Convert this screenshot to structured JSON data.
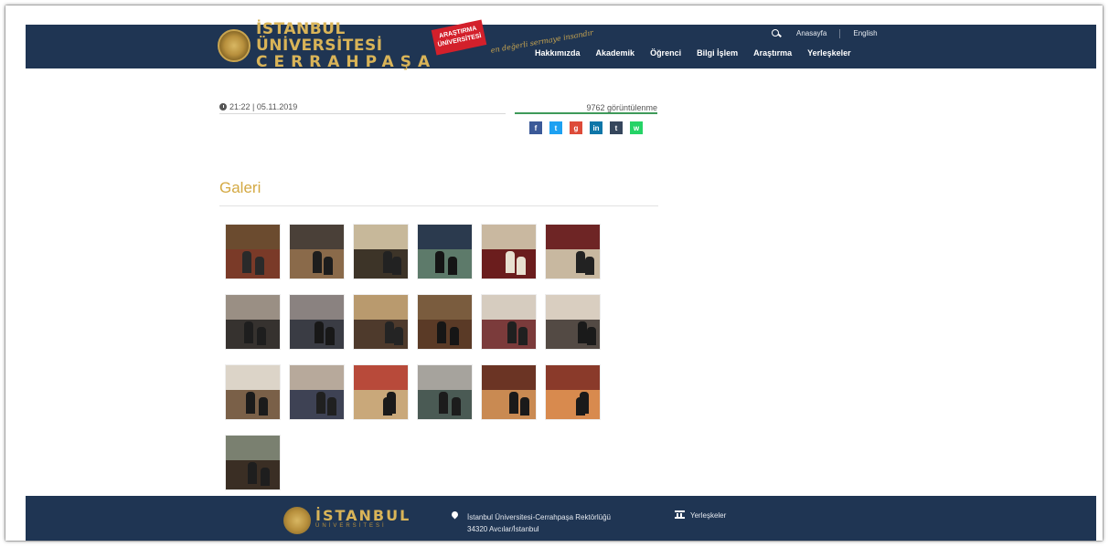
{
  "header": {
    "logo_line1": "İSTANBUL ÜNİVERSİTESİ",
    "logo_line2": "CERRAHPAŞA",
    "badge": "ARAŞTIRMA ÜNİVERSİTESİ",
    "slogan": "en değerli sermaye insandır",
    "search_icon": "search-icon",
    "topbar": {
      "link1": "Anasayfa",
      "link2": "English"
    },
    "nav": [
      "Hakkımızda",
      "Akademik",
      "Öğrenci",
      "Bilgi İşlem",
      "Araştırma",
      "Yerleşkeler"
    ],
    "colors": {
      "bar": "#1f3553",
      "gold": "#d9b458"
    }
  },
  "article": {
    "date": "21:22 | 05.11.2019",
    "views": "9762 görüntülenme",
    "share": [
      {
        "name": "facebook-icon",
        "glyph": "f",
        "color": "#3b5998"
      },
      {
        "name": "twitter-icon",
        "glyph": "t",
        "color": "#1da1f2"
      },
      {
        "name": "google-plus-icon",
        "glyph": "g",
        "color": "#dd4b39"
      },
      {
        "name": "linkedin-icon",
        "glyph": "in",
        "color": "#0e76a8"
      },
      {
        "name": "tumblr-icon",
        "glyph": "t",
        "color": "#35465c"
      },
      {
        "name": "whatsapp-icon",
        "glyph": "w",
        "color": "#25d366"
      }
    ]
  },
  "gallery": {
    "title": "Galeri",
    "photos": [
      {
        "top": "#6b4b2f",
        "bot": "#7a3a28",
        "fig": "#2a2a2a"
      },
      {
        "top": "#4a4038",
        "bot": "#8a6a4a",
        "fig": "#1d1d1d"
      },
      {
        "top": "#c7b89a",
        "bot": "#3d3428",
        "fig": "#222"
      },
      {
        "top": "#2b3a4e",
        "bot": "#5d7a6a",
        "fig": "#151515"
      },
      {
        "top": "#c9b8a0",
        "bot": "#6b1d1d",
        "fig": "#e8e0d0"
      },
      {
        "top": "#6e2525",
        "bot": "#c8b8a0",
        "fig": "#222"
      },
      {
        "top": "#9a8f84",
        "bot": "#36322f",
        "fig": "#1e1e1e"
      },
      {
        "top": "#8a8280",
        "bot": "#3a3c44",
        "fig": "#181818"
      },
      {
        "top": "#b99a6e",
        "bot": "#4e3a2c",
        "fig": "#242424"
      },
      {
        "top": "#7a5c3e",
        "bot": "#5a3a26",
        "fig": "#161616"
      },
      {
        "top": "#d6ccbf",
        "bot": "#7b3b3b",
        "fig": "#202020"
      },
      {
        "top": "#d9cec0",
        "bot": "#534a44",
        "fig": "#1a1a1a"
      },
      {
        "top": "#dcd4c8",
        "bot": "#7a6048",
        "fig": "#1b1b1b"
      },
      {
        "top": "#b7a99b",
        "bot": "#3e4254",
        "fig": "#202020"
      },
      {
        "top": "#b84a3a",
        "bot": "#c9a87a",
        "fig": "#1a1a1a"
      },
      {
        "top": "#a6a39d",
        "bot": "#4a5a54",
        "fig": "#1c1c1c"
      },
      {
        "top": "#6b3424",
        "bot": "#c98a52",
        "fig": "#1a1a1a"
      },
      {
        "top": "#8a3a2a",
        "bot": "#d88a4e",
        "fig": "#1a1a1a"
      },
      {
        "top": "#7a8070",
        "bot": "#3a2e24",
        "fig": "#1e1e1e"
      }
    ]
  },
  "footer": {
    "brand": "İSTANBUL",
    "brand_sub": "ÜNİVERSİTESİ",
    "address": "İstanbul Üniversitesi-Cerrahpaşa Rektörlüğü",
    "address_2": "34320 Avcılar/İstanbul",
    "link": "Yerleşkeler"
  }
}
